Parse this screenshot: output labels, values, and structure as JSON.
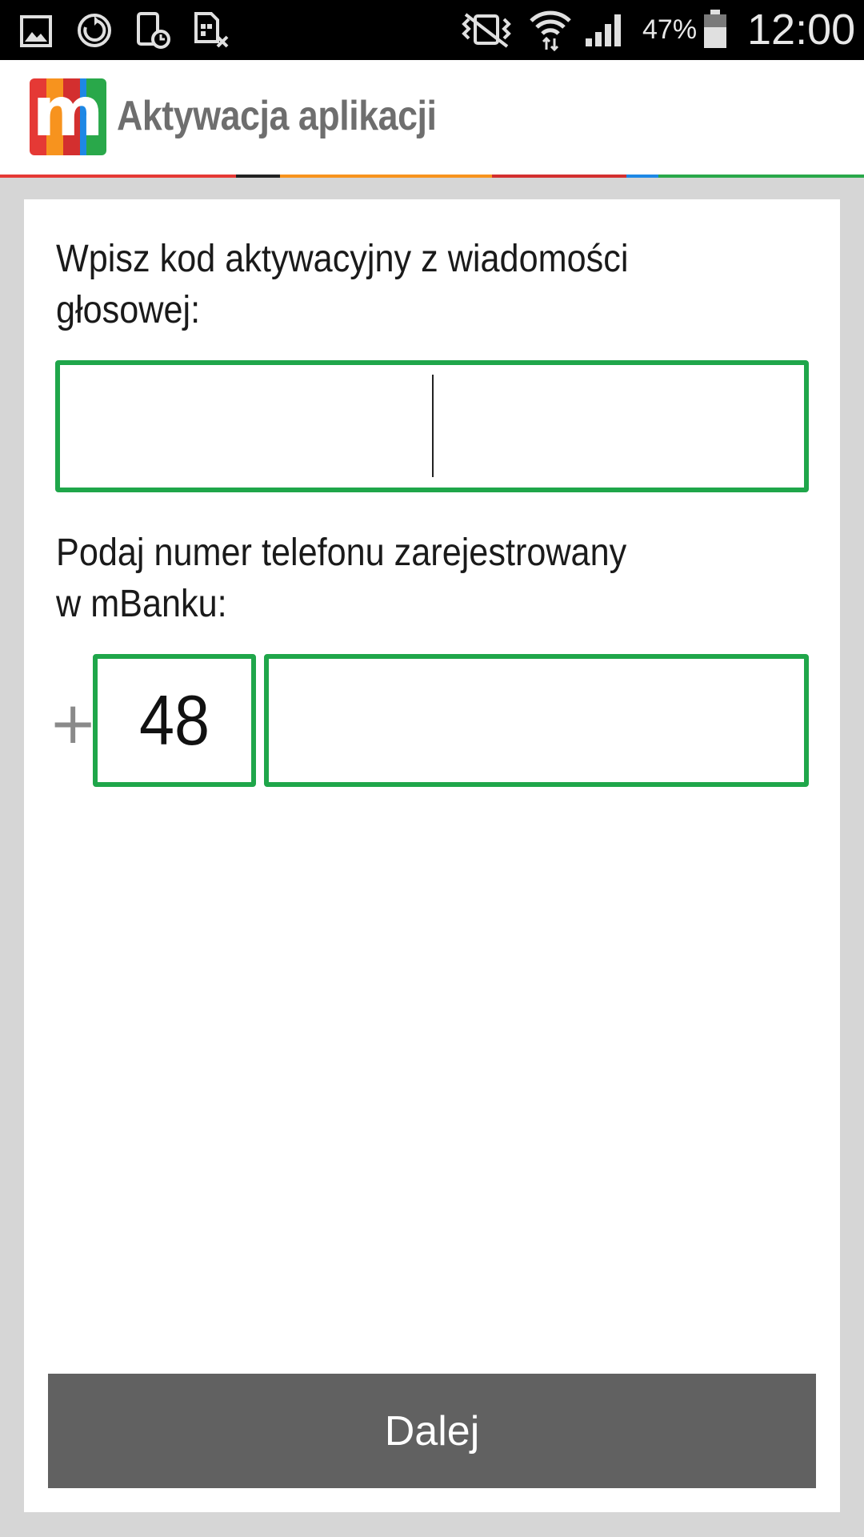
{
  "status_bar": {
    "icons": [
      "gallery-icon",
      "sync-icon",
      "phone-schedule-icon",
      "sim-blocked-icon",
      "vibrate-icon",
      "wifi-icon",
      "signal-icon",
      "battery-icon"
    ],
    "battery_percent": "47%",
    "time": "12:00"
  },
  "app_bar": {
    "logo_letter": "m",
    "title": "Aktywacja aplikacji",
    "logo_colors": [
      "#e53935",
      "#f7931e",
      "#d32f2f",
      "#1e88e5",
      "#29a84a"
    ],
    "accent_colors": [
      "#e53935",
      "#222222",
      "#f7931e",
      "#d32f2f",
      "#1e88e5",
      "#29a84a"
    ]
  },
  "form": {
    "code_label": "Wpisz kod aktywacyjny z wiadomości głosowej:",
    "code_value": "",
    "phone_label": "Podaj numer telefonu zarejestrowany w mBanku:",
    "phone_plus": "+",
    "phone_prefix": "48",
    "phone_value": "",
    "field_border_color": "#1fa64a"
  },
  "actions": {
    "next_label": "Dalej"
  }
}
